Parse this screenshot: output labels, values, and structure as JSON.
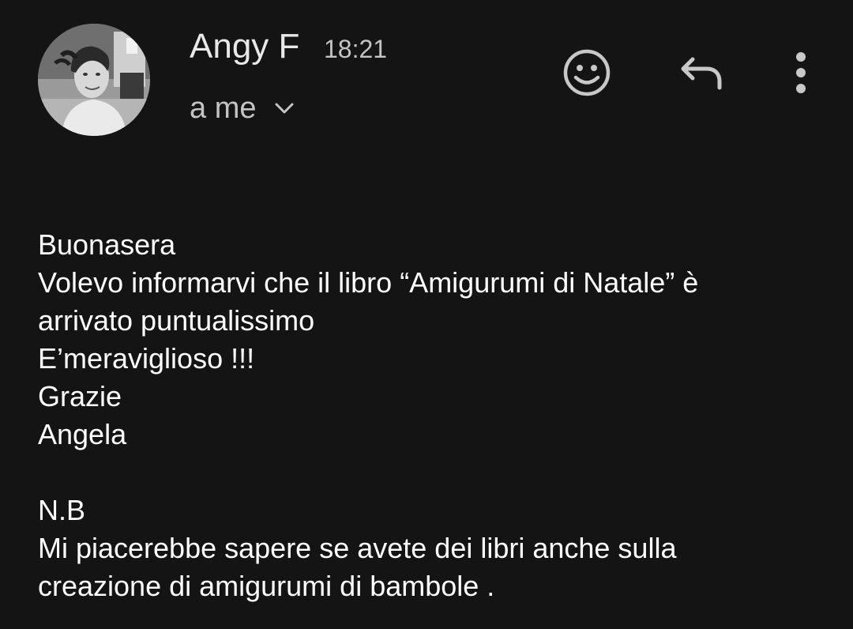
{
  "message": {
    "sender_name": "Angy F",
    "time": "18:21",
    "recipient": "a me",
    "body_lines": [
      "Buonasera",
      "Volevo informarvi che il libro “Amigurumi di Natale” è",
      "arrivato puntualissimo",
      "E’meraviglioso !!!",
      "Grazie",
      "Angela",
      "",
      "N.B",
      "Mi piacerebbe sapere se avete dei libri anche sulla",
      "creazione di amigurumi di bambole ."
    ]
  },
  "icons": {
    "emoji": "smiley-face-icon",
    "reply": "reply-arrow-icon",
    "more": "more-vert-icon",
    "expand": "chevron-down-icon"
  },
  "colors": {
    "background": "#141414",
    "primary_text": "#ffffff",
    "secondary_text": "#c4c4c4",
    "icon": "#c8c8c8"
  }
}
